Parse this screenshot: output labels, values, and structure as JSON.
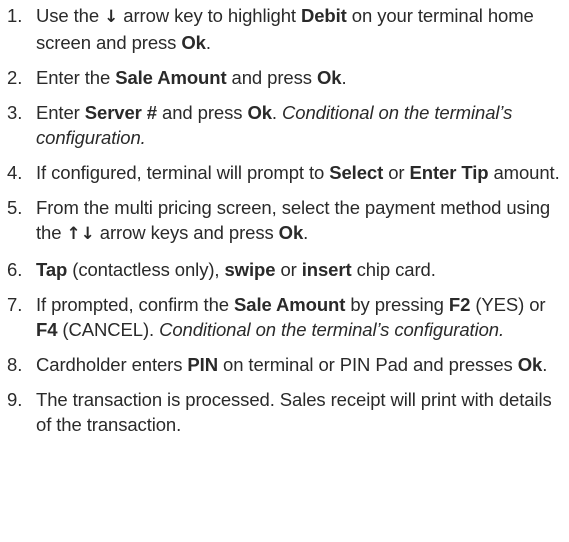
{
  "steps": [
    {
      "num": "1.",
      "segments": [
        {
          "t": "Use the ",
          "s": ""
        },
        {
          "t": "↓",
          "s": "arrow",
          "icon": "arrow-down-icon"
        },
        {
          "t": " arrow key to highlight ",
          "s": ""
        },
        {
          "t": "Debit",
          "s": "b"
        },
        {
          "t": " on your terminal home screen and press ",
          "s": ""
        },
        {
          "t": "Ok",
          "s": "b"
        },
        {
          "t": ".",
          "s": ""
        }
      ]
    },
    {
      "num": "2.",
      "segments": [
        {
          "t": "Enter the ",
          "s": ""
        },
        {
          "t": "Sale Amount",
          "s": "b"
        },
        {
          "t": " and press ",
          "s": ""
        },
        {
          "t": "Ok",
          "s": "b"
        },
        {
          "t": ".",
          "s": ""
        }
      ]
    },
    {
      "num": "3.",
      "segments": [
        {
          "t": "Enter ",
          "s": ""
        },
        {
          "t": "Server #",
          "s": "b"
        },
        {
          "t": " and press ",
          "s": ""
        },
        {
          "t": "Ok",
          "s": "b"
        },
        {
          "t": ". ",
          "s": ""
        },
        {
          "t": "Conditional on the terminal’s configuration.",
          "s": "i"
        }
      ]
    },
    {
      "num": "4.",
      "segments": [
        {
          "t": "If configured, terminal will prompt to ",
          "s": ""
        },
        {
          "t": "Select",
          "s": "b"
        },
        {
          "t": " or ",
          "s": ""
        },
        {
          "t": "Enter Tip",
          "s": "b"
        },
        {
          "t": " amount.",
          "s": ""
        }
      ]
    },
    {
      "num": "5.",
      "segments": [
        {
          "t": "From the multi pricing screen, select the payment method using the ",
          "s": ""
        },
        {
          "t": "↑↓",
          "s": "arrow",
          "icon": "up-down-arrows-icon"
        },
        {
          "t": " arrow keys and press ",
          "s": ""
        },
        {
          "t": "Ok",
          "s": "b"
        },
        {
          "t": ".",
          "s": ""
        }
      ]
    },
    {
      "num": "6.",
      "segments": [
        {
          "t": "Tap",
          "s": "b"
        },
        {
          "t": " (contactless only), ",
          "s": ""
        },
        {
          "t": "swipe",
          "s": "b"
        },
        {
          "t": " or ",
          "s": ""
        },
        {
          "t": "insert",
          "s": "b"
        },
        {
          "t": " chip card.",
          "s": ""
        }
      ]
    },
    {
      "num": "7.",
      "segments": [
        {
          "t": "If prompted, confirm the ",
          "s": ""
        },
        {
          "t": "Sale Amount",
          "s": "b"
        },
        {
          "t": " by pressing ",
          "s": ""
        },
        {
          "t": "F2",
          "s": "b"
        },
        {
          "t": " (YES) or ",
          "s": ""
        },
        {
          "t": "F4",
          "s": "b"
        },
        {
          "t": " (CANCEL). ",
          "s": ""
        },
        {
          "t": "Conditional on the terminal’s configuration.",
          "s": "i"
        }
      ]
    },
    {
      "num": "8.",
      "segments": [
        {
          "t": "Cardholder enters ",
          "s": ""
        },
        {
          "t": "PIN",
          "s": "b"
        },
        {
          "t": " on terminal or PIN Pad and presses ",
          "s": ""
        },
        {
          "t": "Ok",
          "s": "b"
        },
        {
          "t": ".",
          "s": ""
        }
      ]
    },
    {
      "num": "9.",
      "segments": [
        {
          "t": "The transaction is processed. Sales receipt will print with details of the transaction.",
          "s": ""
        }
      ]
    }
  ]
}
